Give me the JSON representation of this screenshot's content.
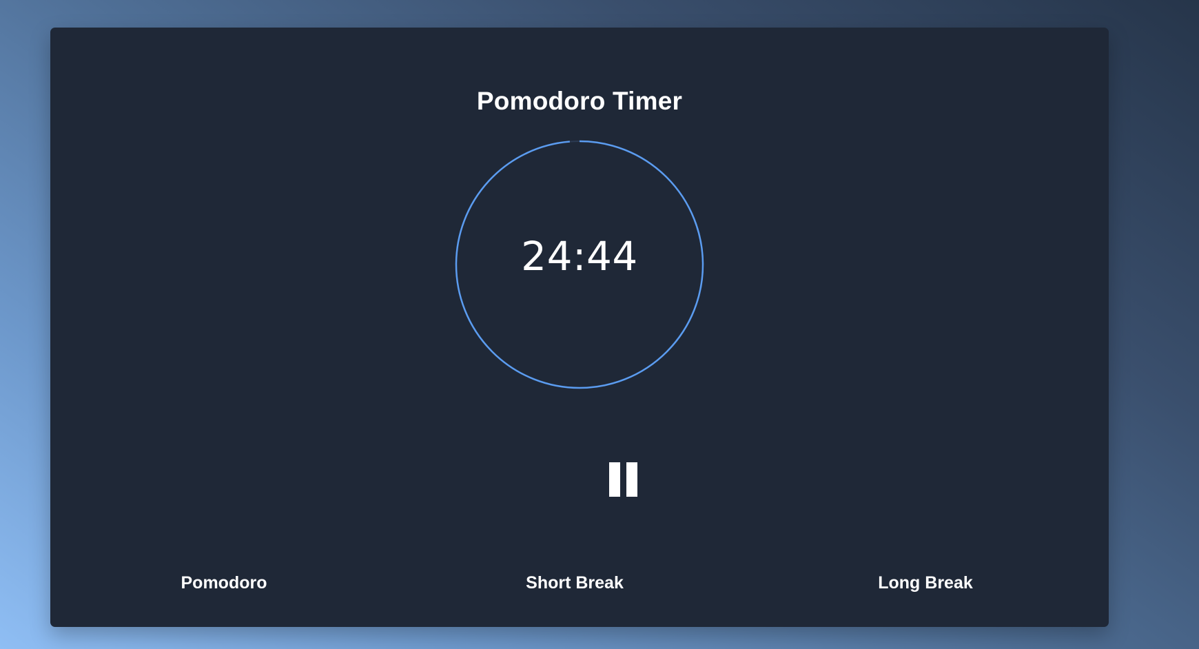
{
  "app": {
    "title": "Pomodoro Timer"
  },
  "timer": {
    "display": "24:44",
    "progress_fraction": 0.987,
    "ring_color": "#5b9cf0",
    "state": "running",
    "control_icon": "pause-icon"
  },
  "modes": [
    {
      "label": "Pomodoro"
    },
    {
      "label": "Short Break"
    },
    {
      "label": "Long Break"
    }
  ],
  "colors": {
    "card_background": "#1f2837",
    "text": "#ffffff",
    "accent": "#5b9cf0"
  }
}
